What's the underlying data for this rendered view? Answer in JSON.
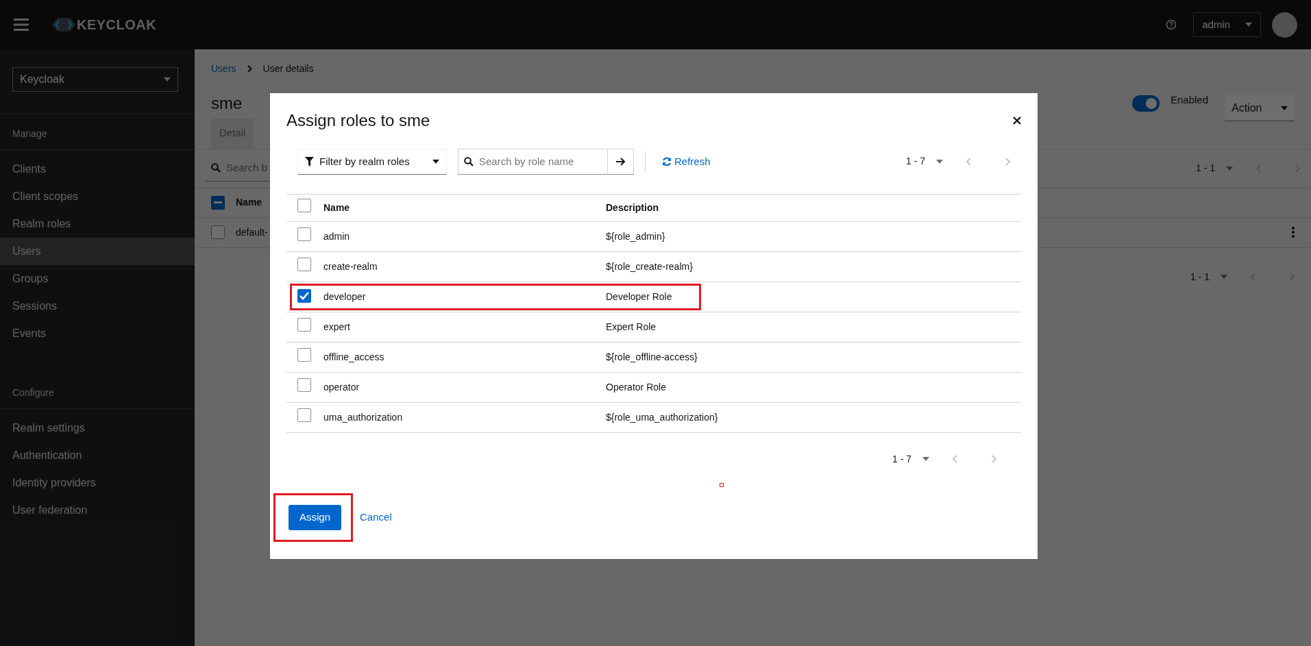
{
  "header": {
    "logo": "KEYCLOAK",
    "user_menu": "admin"
  },
  "sidebar": {
    "realm": "Keycloak",
    "sections": [
      {
        "title": "Manage",
        "items": [
          {
            "label": "Clients",
            "selected": false
          },
          {
            "label": "Client scopes",
            "selected": false
          },
          {
            "label": "Realm roles",
            "selected": false
          },
          {
            "label": "Users",
            "selected": true
          },
          {
            "label": "Groups",
            "selected": false
          },
          {
            "label": "Sessions",
            "selected": false
          },
          {
            "label": "Events",
            "selected": false
          }
        ]
      },
      {
        "title": "Configure",
        "items": [
          {
            "label": "Realm settings",
            "selected": false
          },
          {
            "label": "Authentication",
            "selected": false
          },
          {
            "label": "Identity providers",
            "selected": false
          },
          {
            "label": "User federation",
            "selected": false
          }
        ]
      }
    ]
  },
  "page": {
    "breadcrumb": [
      "Users",
      "User details"
    ],
    "title": "sme",
    "enabled": {
      "label": "Enabled",
      "on": true
    },
    "action": "Action",
    "tabs": [
      {
        "label": "Detail",
        "selected": false
      }
    ],
    "search_placeholder": "Search b",
    "pagination_top": "1 - 1",
    "table": {
      "select_all": {
        "indeterminate": true
      },
      "columns": [
        "Name"
      ],
      "rows": [
        {
          "name": "default-",
          "checked": false
        }
      ]
    },
    "pagination_bottom": "1 - 1"
  },
  "dialog": {
    "title": "Assign roles to sme",
    "filter": "Filter by realm roles",
    "search_placeholder": "Search by role name",
    "refresh": "Refresh",
    "pagination_top": "1 - 7",
    "select_all": {
      "checked": false
    },
    "columns": [
      "Name",
      "Description"
    ],
    "rows": [
      {
        "name": "admin",
        "description": "${role_admin}",
        "checked": false,
        "highlighted": false
      },
      {
        "name": "create-realm",
        "description": "${role_create-realm}",
        "checked": false,
        "highlighted": false
      },
      {
        "name": "developer",
        "description": "Developer Role",
        "checked": true,
        "highlighted": true
      },
      {
        "name": "expert",
        "description": "Expert Role",
        "checked": false,
        "highlighted": false
      },
      {
        "name": "offline_access",
        "description": "${role_offline-access}",
        "checked": false,
        "highlighted": false
      },
      {
        "name": "operator",
        "description": "Operator Role",
        "checked": false,
        "highlighted": false
      },
      {
        "name": "uma_authorization",
        "description": "${role_uma_authorization}",
        "checked": false,
        "highlighted": false
      }
    ],
    "pagination_bottom": "1 - 7",
    "buttons": [
      {
        "label": "Assign",
        "kind": "primary",
        "highlighted": true
      },
      {
        "label": "Cancel",
        "kind": "link",
        "highlighted": false
      }
    ]
  }
}
